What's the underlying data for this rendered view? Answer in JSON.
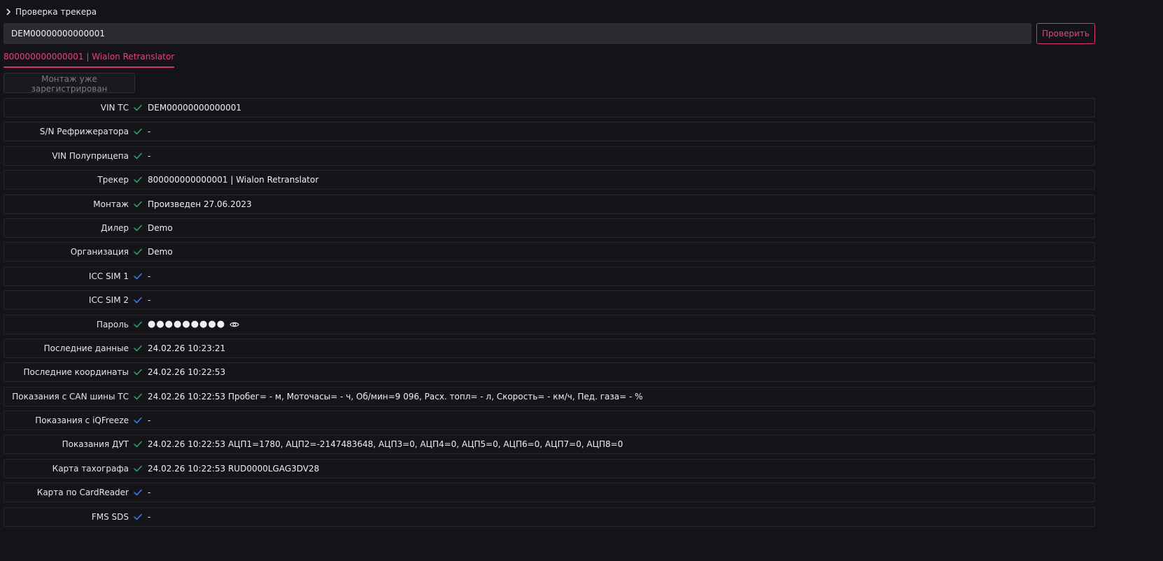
{
  "header": {
    "title": "Проверка трекера",
    "icon": "chevron-right-icon"
  },
  "search": {
    "value": "DEM00000000000001",
    "button_label": "Проверить"
  },
  "tab": {
    "label": "800000000000001 | Wialon Retranslator"
  },
  "registered_button": {
    "label": "Монтаж уже зарегистрирован"
  },
  "colors": {
    "accent": "#d6386b",
    "ok_green": "#2ea86b",
    "info_blue": "#3b82f6"
  },
  "rows": [
    {
      "label": "VIN ТС",
      "status": "green",
      "value": "DEM00000000000001"
    },
    {
      "label": "S/N Рефрижератора",
      "status": "green",
      "value": "-"
    },
    {
      "label": "VIN Полуприцепа",
      "status": "green",
      "value": "-"
    },
    {
      "label": "Трекер",
      "status": "green",
      "value": "800000000000001 | Wialon Retranslator"
    },
    {
      "label": "Монтаж",
      "status": "green",
      "value": "Произведен 27.06.2023"
    },
    {
      "label": "Дилер",
      "status": "green",
      "value": "Demo"
    },
    {
      "label": "Организация",
      "status": "green",
      "value": "Demo"
    },
    {
      "label": "ICC SIM 1",
      "status": "blue",
      "value": "-"
    },
    {
      "label": "ICC SIM 2",
      "status": "blue",
      "value": "-"
    },
    {
      "label": "Пароль",
      "status": "green",
      "value": "●●●●●●●●●",
      "password": true
    },
    {
      "label": "Последние данные",
      "status": "green",
      "value": "24.02.26 10:23:21"
    },
    {
      "label": "Последние координаты",
      "status": "green",
      "value": "24.02.26 10:22:53"
    },
    {
      "label": "Показания с CAN шины ТС",
      "status": "green",
      "value": "24.02.26 10:22:53 Пробег= - м, Моточасы= - ч, Об/мин=9 096, Расх. топл= - л, Скорость= - км/ч, Пед. газа= - %"
    },
    {
      "label": "Показания с iQFreeze",
      "status": "blue",
      "value": "-"
    },
    {
      "label": "Показания ДУТ",
      "status": "green",
      "value": "24.02.26 10:22:53 АЦП1=1780, АЦП2=-2147483648, АЦП3=0, АЦП4=0, АЦП5=0, АЦП6=0, АЦП7=0, АЦП8=0"
    },
    {
      "label": "Карта тахографа",
      "status": "green",
      "value": "24.02.26 10:22:53 RUD0000LGAG3DV28"
    },
    {
      "label": "Карта по CardReader",
      "status": "blue",
      "value": "-"
    },
    {
      "label": "FMS SDS",
      "status": "blue",
      "value": "-"
    }
  ]
}
